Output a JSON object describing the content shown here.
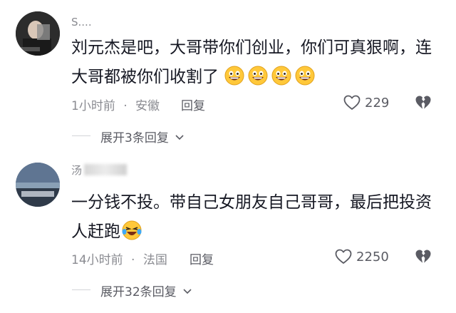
{
  "comments": [
    {
      "username": "S....",
      "text_line1": "刘元杰是吧，大哥带你们创业，你们可真狠啊，连",
      "text_line2": "大哥都被你们收割了",
      "emojis": [
        "grin-emoji",
        "grin-emoji",
        "grin-emoji",
        "grin-emoji"
      ],
      "time": "1小时前",
      "location": "安徽",
      "reply_label": "回复",
      "likes": "229",
      "expand_label": "展开3条回复"
    },
    {
      "username": "汤",
      "text_line1": "一分钱不投。带自己女朋友自己哥哥，最后把投资",
      "text_line2": "人赶跑",
      "emojis": [
        "laugh-cry-emoji"
      ],
      "time": "14小时前",
      "location": "法国",
      "reply_label": "回复",
      "likes": "2250",
      "expand_label": "展开32条回复"
    }
  ],
  "separator": "·",
  "colors": {
    "text": "#161823",
    "meta": "#8a8b91",
    "emoji_face": "#ffc83a"
  }
}
